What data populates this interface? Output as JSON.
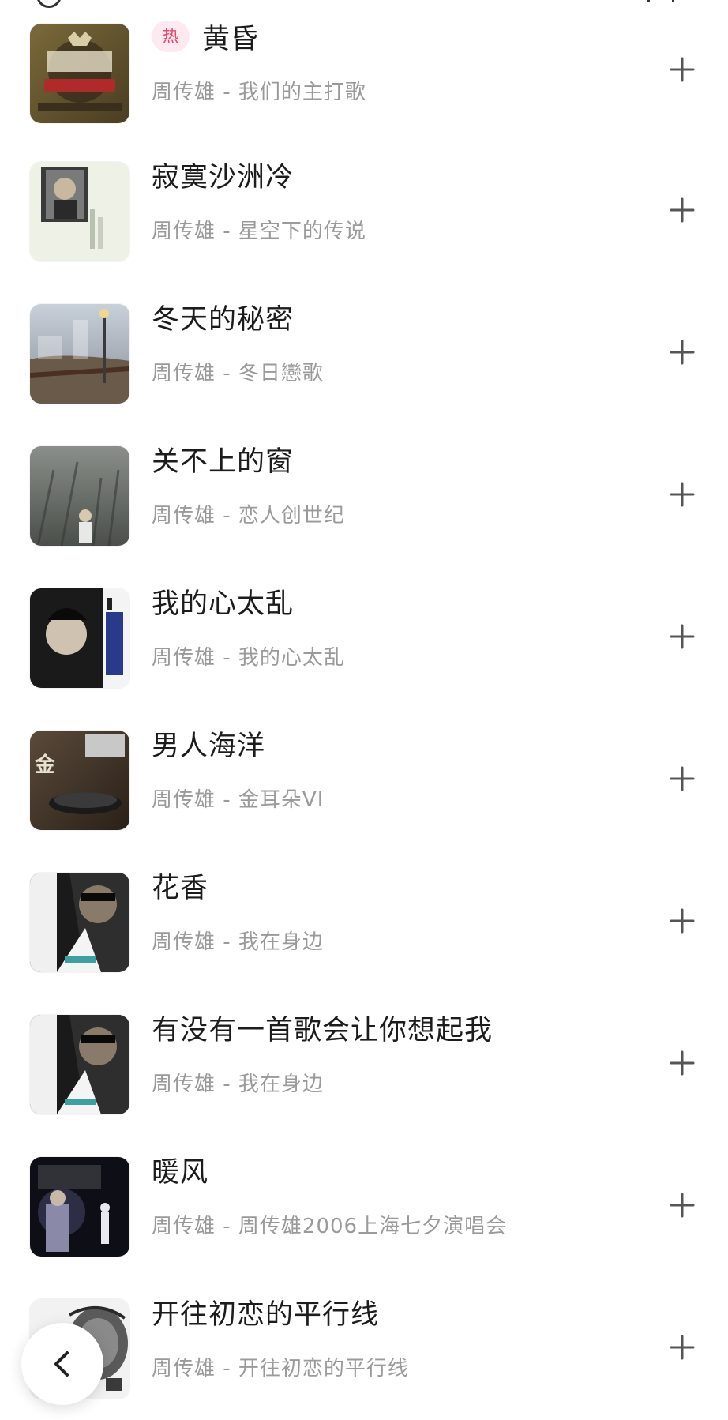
{
  "hot_badge": "热",
  "songs": [
    {
      "title": "黄昏",
      "subtitle": "周传雄 - 我们的主打歌",
      "hot": true
    },
    {
      "title": "寂寞沙洲冷",
      "subtitle": "周传雄 - 星空下的传说"
    },
    {
      "title": "冬天的秘密",
      "subtitle": "周传雄 - 冬日戀歌"
    },
    {
      "title": "关不上的窗",
      "subtitle": "周传雄 - 恋人创世纪"
    },
    {
      "title": "我的心太乱",
      "subtitle": "周传雄 - 我的心太乱"
    },
    {
      "title": "男人海洋",
      "subtitle": "周传雄 - 金耳朵VI"
    },
    {
      "title": "花香",
      "subtitle": "周传雄 - 我在身边"
    },
    {
      "title": "有没有一首歌会让你想起我",
      "subtitle": "周传雄 - 我在身边"
    },
    {
      "title": "暖风",
      "subtitle": "周传雄 - 周传雄2006上海七夕演唱会"
    },
    {
      "title": "开往初恋的平行线",
      "subtitle": "周传雄 - 开往初恋的平行线"
    }
  ],
  "colors": {
    "title": "#1c1c1c",
    "subtitle": "#9a9a9a",
    "hot_badge_bg": "#fdeaf0",
    "hot_badge_text": "#e8476c",
    "icon": "#555555"
  },
  "icons": {
    "add": "plus-icon",
    "back": "chevron-left-icon"
  }
}
